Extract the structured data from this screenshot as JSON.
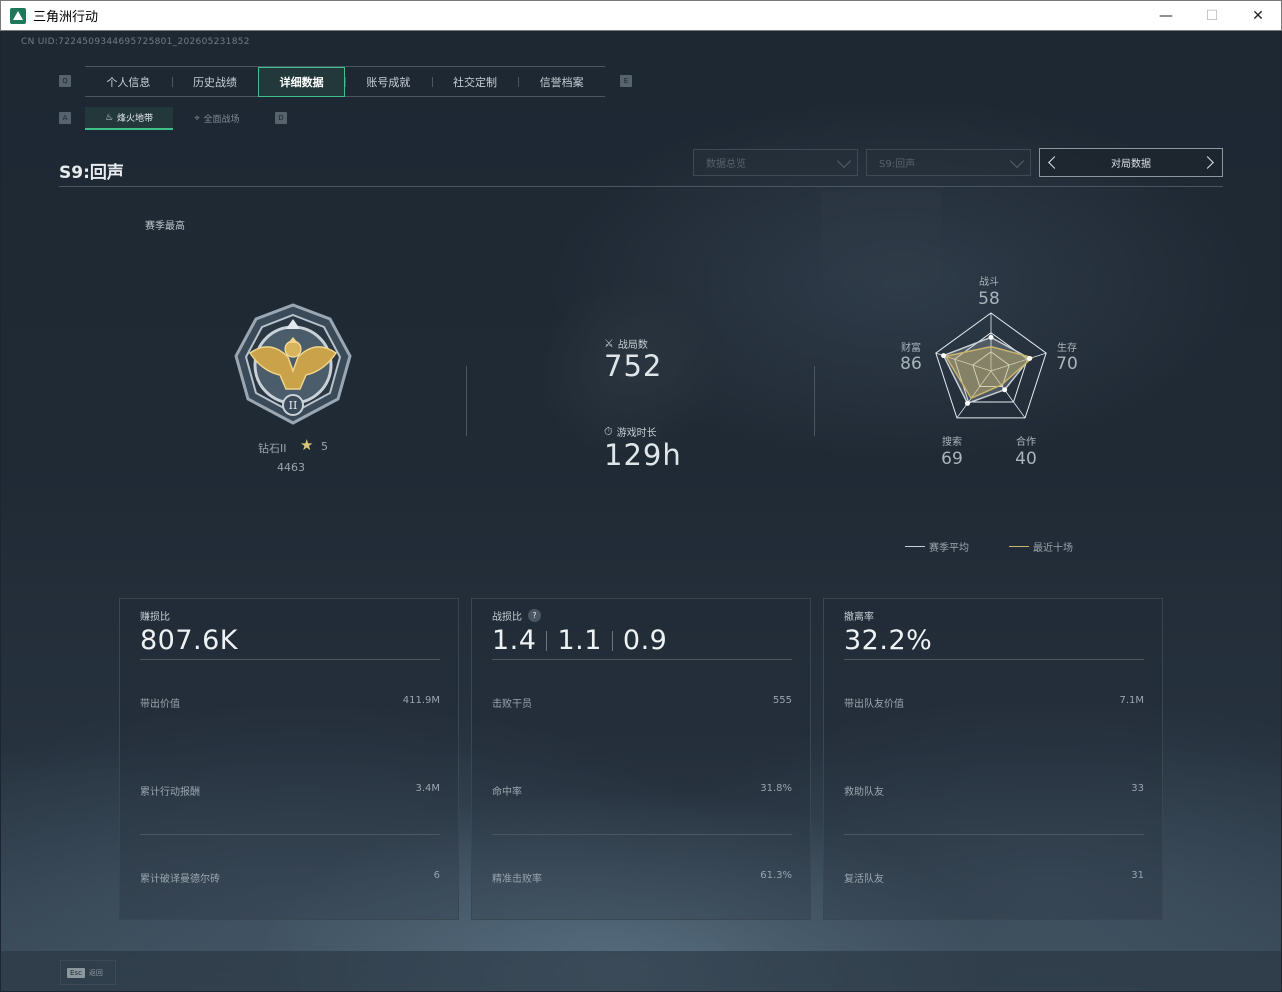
{
  "window": {
    "title": "三角洲行动",
    "minimize": "—",
    "maximize": "☐",
    "close": "✕"
  },
  "uid": "CN UID:7224509344695725801_202605231852",
  "tabs": {
    "left_key": "Q",
    "right_key": "E",
    "items": [
      "个人信息",
      "历史战绩",
      "详细数据",
      "账号成就",
      "社交定制",
      "信誉档案"
    ],
    "active": "详细数据"
  },
  "subtabs": {
    "left_key": "A",
    "right_key": "D",
    "items": [
      {
        "label": "烽火地带",
        "icon": "beacon-icon"
      },
      {
        "label": "全面战场",
        "icon": "crosshair-icon"
      }
    ],
    "active": "烽火地带"
  },
  "season_title": "S9:回声",
  "filters": {
    "data_select": "数据总览",
    "season_select": "S9:回声",
    "switch_label": "对局数据"
  },
  "rank": {
    "section_label": "赛季最高",
    "name": "钻石II",
    "stars": "5",
    "score": "4463",
    "tier_numeral": "II"
  },
  "stats": {
    "matches_label": "战局数",
    "matches_value": "752",
    "playtime_label": "游戏时长",
    "playtime_value": "129h"
  },
  "radar": {
    "axes": [
      {
        "label": "战斗",
        "value": "58"
      },
      {
        "label": "生存",
        "value": "70"
      },
      {
        "label": "合作",
        "value": "40"
      },
      {
        "label": "搜索",
        "value": "69"
      },
      {
        "label": "财富",
        "value": "86"
      }
    ],
    "season_avg": [
      58,
      70,
      40,
      69,
      86
    ],
    "recent_ten": [
      42,
      75,
      30,
      58,
      82
    ],
    "legend": {
      "season_avg": "赛季平均",
      "recent_ten": "最近十场"
    },
    "colors": {
      "season_avg": "#c8d0d6",
      "recent_ten": "#c8b46a"
    }
  },
  "cards": [
    {
      "title": "赚损比",
      "main": "807.6K",
      "rows": [
        {
          "label": "带出价值",
          "value": "411.9M"
        },
        {
          "label": "累计行动报酬",
          "value": "3.4M"
        },
        {
          "label": "累计破译曼德尔砖",
          "value": "6"
        }
      ]
    },
    {
      "title": "战损比",
      "main_parts": [
        "1.4",
        "1.1",
        "0.9"
      ],
      "rows": [
        {
          "label": "击败干员",
          "value": "555"
        },
        {
          "label": "命中率",
          "value": "31.8%"
        },
        {
          "label": "精准击败率",
          "value": "61.3%"
        }
      ]
    },
    {
      "title": "撤离率",
      "main": "32.2%",
      "rows": [
        {
          "label": "带出队友价值",
          "value": "7.1M"
        },
        {
          "label": "救助队友",
          "value": "33"
        },
        {
          "label": "复活队友",
          "value": "31"
        }
      ]
    }
  ],
  "footer": {
    "esc_key": "Esc",
    "esc_label": "返回"
  },
  "colors": {
    "accent": "#3fbf8a",
    "background": "#1c2530"
  }
}
